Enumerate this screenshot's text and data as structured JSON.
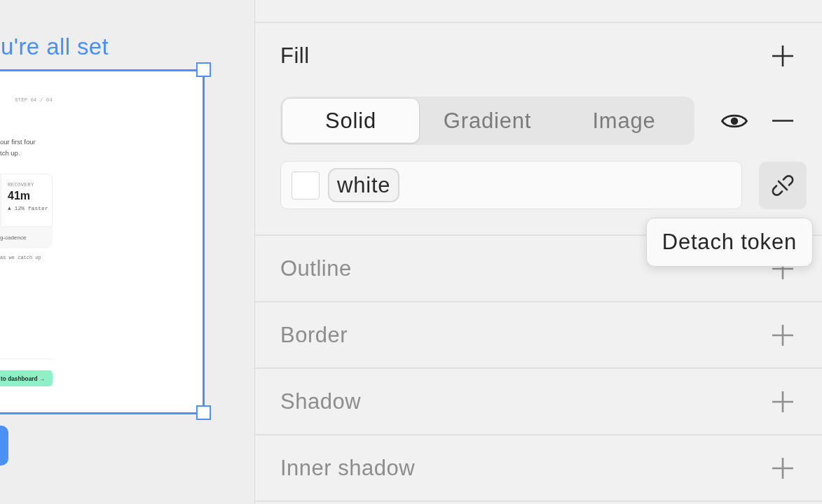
{
  "canvas": {
    "frame_label": "u're all set",
    "artboard": {
      "selected": true,
      "step": "STEP 04 / 04",
      "body_lines": [
        "our first four",
        "tch up."
      ],
      "stat": {
        "label": "RECOVERY",
        "value": "41m",
        "change": "▲ 12% faster"
      },
      "card_footer": "g-cadence",
      "note": "as we catch up",
      "cta": "to dashboard →"
    }
  },
  "panel": {
    "fill": {
      "title": "Fill",
      "modes": [
        {
          "label": "Solid",
          "selected": true
        },
        {
          "label": "Gradient",
          "selected": false
        },
        {
          "label": "Image",
          "selected": false
        }
      ],
      "visible": true,
      "token": "white",
      "tooltip": "Detach token"
    },
    "sections": [
      {
        "title": "Outline"
      },
      {
        "title": "Border"
      },
      {
        "title": "Shadow"
      },
      {
        "title": "Inner shadow"
      }
    ]
  }
}
